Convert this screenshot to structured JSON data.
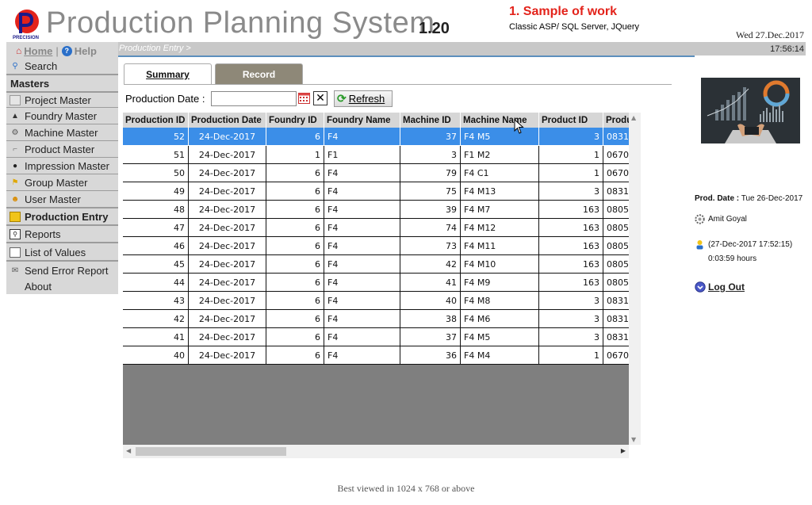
{
  "header": {
    "title": "Production Planning System",
    "version": "1.20",
    "sample_title": "1. Sample of work",
    "sample_subtitle": "Classic ASP/ SQL Server, JQuery",
    "date": "Wed 27.Dec.2017",
    "time": "17:56:14",
    "logo_text": "PRECISION"
  },
  "topnav": {
    "home": "Home",
    "help": "Help"
  },
  "breadcrumb": "Production Entry >",
  "sidebar": {
    "search": "Search",
    "masters_heading": "Masters",
    "items": [
      {
        "label": "Project Master",
        "icon": "project-icon"
      },
      {
        "label": "Foundry Master",
        "icon": "foundry-icon"
      },
      {
        "label": "Machine Master",
        "icon": "machine-icon"
      },
      {
        "label": "Product Master",
        "icon": "product-icon"
      },
      {
        "label": "Impression Master",
        "icon": "impression-icon"
      },
      {
        "label": "Group Master",
        "icon": "flag-icon"
      },
      {
        "label": "User Master",
        "icon": "user-icon"
      }
    ],
    "production_entry": "Production Entry",
    "reports": "Reports",
    "list_of_values": "List of Values",
    "send_error_report": "Send Error Report",
    "about": "About"
  },
  "tabs": {
    "summary": "Summary",
    "record": "Record"
  },
  "filter": {
    "label": "Production Date :",
    "value": "",
    "refresh": "Refresh"
  },
  "grid": {
    "columns": [
      "Production ID",
      "Production Date",
      "Foundry ID",
      "Foundry Name",
      "Machine ID",
      "Machine Name",
      "Product ID",
      "Produ"
    ],
    "rows": [
      [
        "52",
        "24-Dec-2017",
        "6",
        "F4",
        "37",
        "F4 M5",
        "3",
        "0831"
      ],
      [
        "51",
        "24-Dec-2017",
        "1",
        "F1",
        "3",
        "F1 M2",
        "1",
        "0670"
      ],
      [
        "50",
        "24-Dec-2017",
        "6",
        "F4",
        "79",
        "F4 C1",
        "1",
        "0670"
      ],
      [
        "49",
        "24-Dec-2017",
        "6",
        "F4",
        "75",
        "F4 M13",
        "3",
        "0831"
      ],
      [
        "48",
        "24-Dec-2017",
        "6",
        "F4",
        "39",
        "F4 M7",
        "163",
        "0805"
      ],
      [
        "47",
        "24-Dec-2017",
        "6",
        "F4",
        "74",
        "F4 M12",
        "163",
        "0805"
      ],
      [
        "46",
        "24-Dec-2017",
        "6",
        "F4",
        "73",
        "F4 M11",
        "163",
        "0805"
      ],
      [
        "45",
        "24-Dec-2017",
        "6",
        "F4",
        "42",
        "F4 M10",
        "163",
        "0805"
      ],
      [
        "44",
        "24-Dec-2017",
        "6",
        "F4",
        "41",
        "F4 M9",
        "163",
        "0805"
      ],
      [
        "43",
        "24-Dec-2017",
        "6",
        "F4",
        "40",
        "F4 M8",
        "3",
        "0831"
      ],
      [
        "42",
        "24-Dec-2017",
        "6",
        "F4",
        "38",
        "F4 M6",
        "3",
        "0831"
      ],
      [
        "41",
        "24-Dec-2017",
        "6",
        "F4",
        "37",
        "F4 M5",
        "3",
        "0831"
      ],
      [
        "40",
        "24-Dec-2017",
        "6",
        "F4",
        "36",
        "F4 M4",
        "1",
        "0670"
      ]
    ],
    "selected_row": 0
  },
  "info": {
    "prod_date_label": "Prod. Date :",
    "prod_date_value": "Tue 26-Dec-2017",
    "user": "Amit Goyal",
    "login_time": "(27-Dec-2017 17:52:15)",
    "duration": "0:03:59 hours",
    "logout": "Log Out"
  },
  "footer": "Best viewed in 1024 x 768 or above",
  "colors": {
    "accent": "#3b8ee8",
    "sample_title": "#e3231b",
    "tab_inactive": "#8e8878"
  }
}
